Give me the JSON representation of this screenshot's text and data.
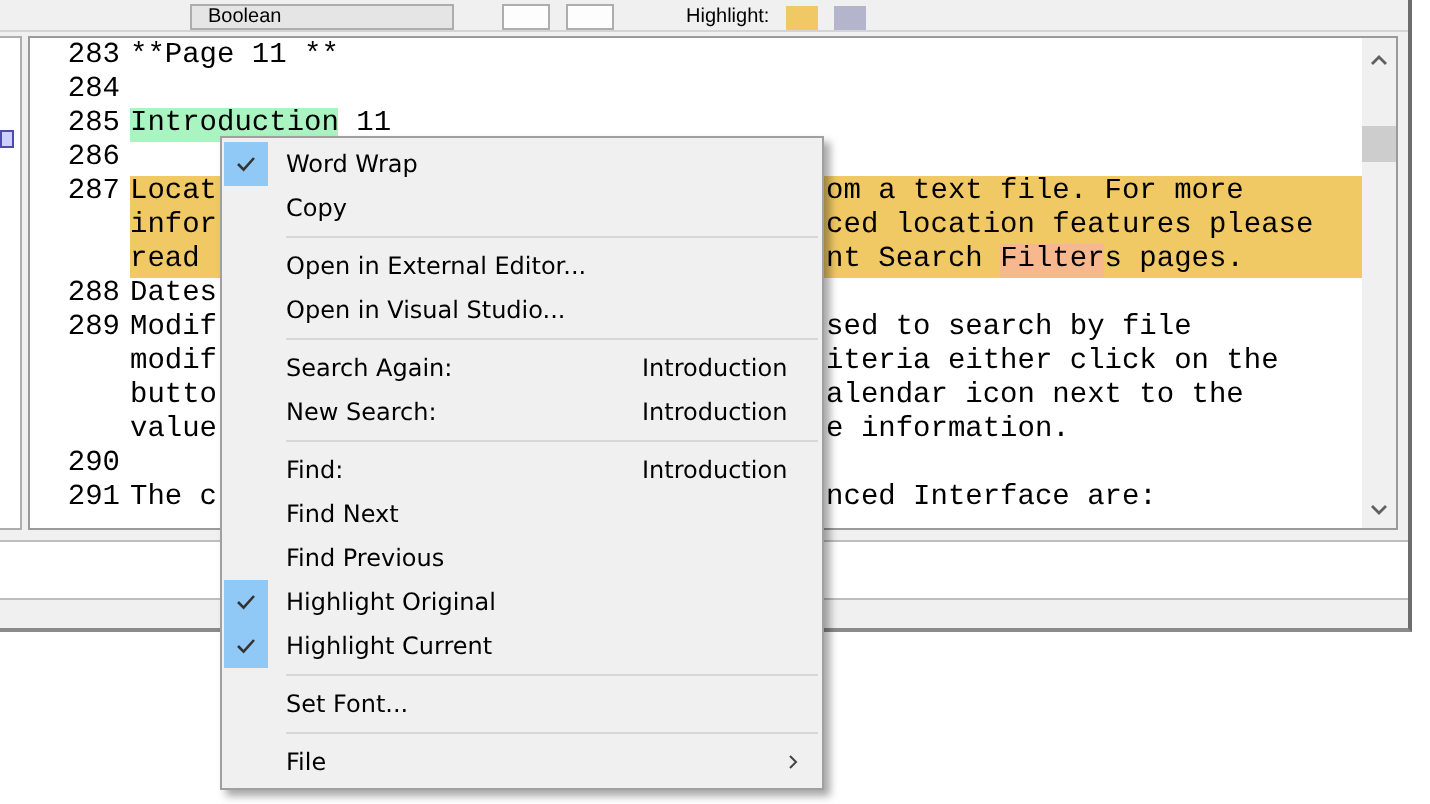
{
  "toolbar": {
    "dropdown": "Boolean",
    "highlight_label": "Highlight:"
  },
  "editor": {
    "rows": [
      {
        "number": "283",
        "row_highlight": false,
        "left": [
          {
            "text": "**Page 11 **"
          }
        ],
        "right": []
      },
      {
        "number": "284",
        "row_highlight": false,
        "left": [],
        "right": []
      },
      {
        "number": "285",
        "row_highlight": false,
        "left": [
          {
            "text": "Introduction",
            "color": "#aaf4c2"
          },
          {
            "text": " 11"
          }
        ],
        "right": []
      },
      {
        "number": "286",
        "row_highlight": false,
        "left": [],
        "right": []
      },
      {
        "number": "287",
        "row_highlight": true,
        "left": [
          {
            "text": "Locat"
          }
        ],
        "right": [
          {
            "text": "om a text file. For more"
          }
        ]
      },
      {
        "number": "",
        "row_highlight": true,
        "left": [
          {
            "text": "infor"
          }
        ],
        "right": [
          {
            "text": "ced location features please"
          }
        ]
      },
      {
        "number": "",
        "row_highlight": true,
        "left": [
          {
            "text": "read"
          }
        ],
        "right": [
          {
            "text": "nt Search "
          },
          {
            "text": "Filter",
            "color": "#f7b88e"
          },
          {
            "text": "s pages."
          }
        ]
      },
      {
        "number": "288",
        "row_highlight": false,
        "left": [
          {
            "text": "Dates"
          }
        ],
        "right": []
      },
      {
        "number": "289",
        "row_highlight": false,
        "left": [
          {
            "text": "Modif"
          }
        ],
        "right": [
          {
            "text": "sed to search by file"
          }
        ]
      },
      {
        "number": "",
        "row_highlight": false,
        "left": [
          {
            "text": "modif"
          }
        ],
        "right": [
          {
            "text": "iteria either click on the"
          }
        ]
      },
      {
        "number": "",
        "row_highlight": false,
        "left": [
          {
            "text": "butto"
          }
        ],
        "right": [
          {
            "text": "alendar icon next to the"
          }
        ]
      },
      {
        "number": "",
        "row_highlight": false,
        "left": [
          {
            "text": "value"
          }
        ],
        "right": [
          {
            "text": "e information."
          }
        ]
      },
      {
        "number": "290",
        "row_highlight": false,
        "left": [],
        "right": []
      },
      {
        "number": "291",
        "row_highlight": false,
        "left": [
          {
            "text": "The c"
          }
        ],
        "right": [
          {
            "text": "nced Interface are:"
          }
        ]
      }
    ]
  },
  "context_menu": {
    "items": [
      {
        "kind": "item",
        "label": "Word Wrap",
        "checked": true
      },
      {
        "kind": "item",
        "label": "Copy",
        "checked": false
      },
      {
        "kind": "separator"
      },
      {
        "kind": "item",
        "label": "Open in External Editor...",
        "checked": false
      },
      {
        "kind": "item",
        "label": "Open in Visual Studio...",
        "checked": false
      },
      {
        "kind": "separator"
      },
      {
        "kind": "item",
        "label": "Search Again:",
        "value": "Introduction",
        "checked": false
      },
      {
        "kind": "item",
        "label": "New Search:",
        "value": "Introduction",
        "checked": false
      },
      {
        "kind": "separator"
      },
      {
        "kind": "item",
        "label": "Find:",
        "value": "Introduction",
        "checked": false
      },
      {
        "kind": "item",
        "label": "Find Next",
        "checked": false
      },
      {
        "kind": "item",
        "label": "Find Previous",
        "checked": false
      },
      {
        "kind": "item",
        "label": "Highlight Original",
        "checked": true
      },
      {
        "kind": "item",
        "label": "Highlight Current",
        "checked": true
      },
      {
        "kind": "separator"
      },
      {
        "kind": "item",
        "label": "Set Font...",
        "checked": false
      },
      {
        "kind": "separator"
      },
      {
        "kind": "submenu",
        "label": "File"
      }
    ]
  }
}
